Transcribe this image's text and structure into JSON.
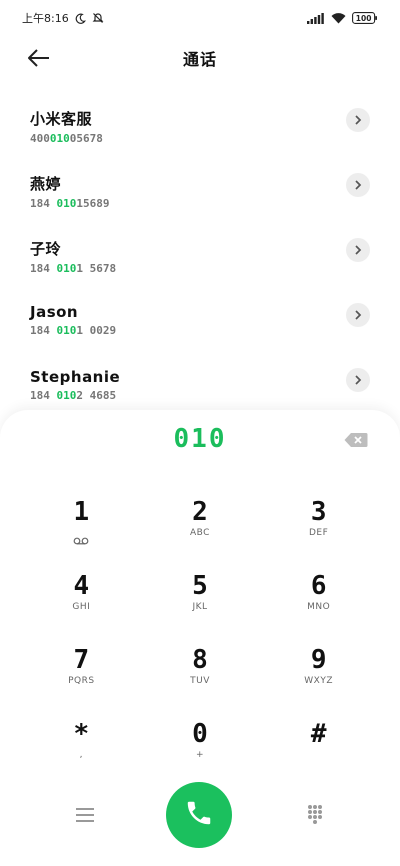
{
  "status_bar": {
    "time": "上午8:16",
    "battery": "100"
  },
  "header": {
    "title": "通话"
  },
  "contacts": [
    {
      "name": "小米客服",
      "number_prefix": "400",
      "number_match": "010",
      "number_suffix": "05678"
    },
    {
      "name": "燕婷",
      "number_prefix": "184 ",
      "number_match": "010",
      "number_suffix": "15689"
    },
    {
      "name": "子玲",
      "number_prefix": "184 ",
      "number_match": "010",
      "number_suffix": "1 5678"
    },
    {
      "name": "Jason",
      "number_prefix": "184 ",
      "number_match": "010",
      "number_suffix": "1 0029"
    },
    {
      "name": "Stephanie",
      "number_prefix": "184 ",
      "number_match": "010",
      "number_suffix": "2 4685"
    }
  ],
  "dialpad": {
    "input": "010",
    "keys": [
      {
        "digit": "1",
        "sub": ""
      },
      {
        "digit": "2",
        "sub": "ABC"
      },
      {
        "digit": "3",
        "sub": "DEF"
      },
      {
        "digit": "4",
        "sub": "GHI"
      },
      {
        "digit": "5",
        "sub": "JKL"
      },
      {
        "digit": "6",
        "sub": "MNO"
      },
      {
        "digit": "7",
        "sub": "PQRS"
      },
      {
        "digit": "8",
        "sub": "TUV"
      },
      {
        "digit": "9",
        "sub": "WXYZ"
      },
      {
        "digit": "*",
        "sub": ","
      },
      {
        "digit": "0",
        "sub": "+"
      },
      {
        "digit": "#",
        "sub": ""
      }
    ]
  },
  "icons": {
    "back": "arrow-left-icon",
    "detail": "chevron-right-icon",
    "backspace": "backspace-icon",
    "voicemail": "voicemail-icon",
    "menu": "menu-icon",
    "call": "phone-icon",
    "keypad": "keypad-icon"
  },
  "colors": {
    "accent": "#1bbd5c",
    "call_button": "#1bc05e"
  }
}
